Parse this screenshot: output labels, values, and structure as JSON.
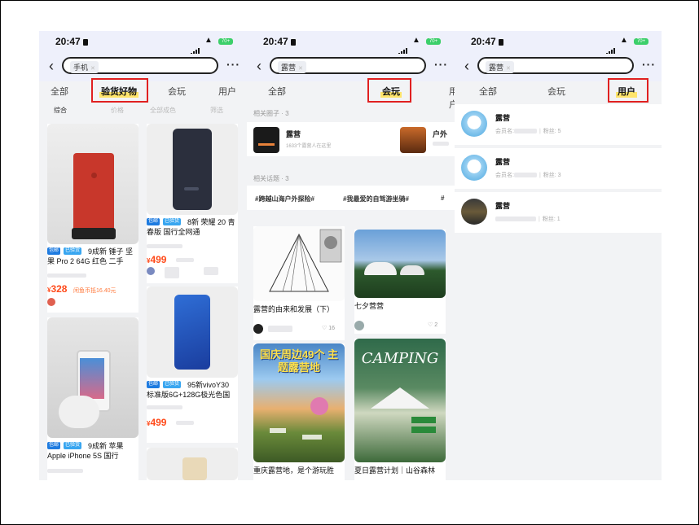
{
  "status": {
    "time": "20:47",
    "battery": "70+"
  },
  "panels": [
    {
      "query": "手机",
      "tabs": [
        "全部",
        "验货好物",
        "会玩",
        "用户"
      ],
      "active_tab": 1,
      "filters": [
        "综合",
        "价格",
        "全部成色",
        "筛选"
      ],
      "products": [
        {
          "badges": [
            "包邮",
            "已验货"
          ],
          "title": "9成新 锤子 坚果 Pro 2 64G 红色 二手",
          "price": "328",
          "note": "闲鱼币抵16.40元"
        },
        {
          "badges": [
            "包邮",
            "已验货"
          ],
          "title": "8新 荣耀 20 青春版 国行全网通",
          "price": "499"
        },
        {
          "badges": [
            "包邮",
            "已验货"
          ],
          "title": "95新vivoY30 标准版6G+128G极光色国",
          "price": "499"
        },
        {
          "badges": [
            "包邮",
            "已验货"
          ],
          "title": "9成新 苹果 Apple iPhone 5S 国行"
        }
      ]
    },
    {
      "query": "露营",
      "tabs": [
        "全部",
        "会玩",
        "用户"
      ],
      "active_tab": 1,
      "circles_heading": "相关圈子 · 3",
      "circles": [
        {
          "name": "露营",
          "sub": "1633个露营人在这里"
        },
        {
          "name": "户外"
        }
      ],
      "topics_heading": "相关话题 · 3",
      "topics": [
        "#跨越山海户外探险#",
        "#我最爱的自驾游坐骑#"
      ],
      "posts": [
        {
          "title": "露营的由来和发展（下）",
          "likes": "16"
        },
        {
          "title": "七夕营营",
          "likes": "2"
        },
        {
          "title": "重庆露营地，是个游玩胜",
          "poster": "国庆周边49个 主题露营地"
        },
        {
          "title": "夏日露营计划｜山谷森林",
          "poster": "CAMPING"
        }
      ]
    },
    {
      "query": "露营",
      "tabs": [
        "全部",
        "会玩",
        "用户"
      ],
      "active_tab": 2,
      "users": [
        {
          "name": "露营",
          "fans": "5"
        },
        {
          "name": "露营",
          "fans": "3"
        },
        {
          "name": "露营",
          "fans": "1"
        }
      ],
      "user_meta_label": "会员名",
      "fans_label": "粉丝"
    }
  ]
}
